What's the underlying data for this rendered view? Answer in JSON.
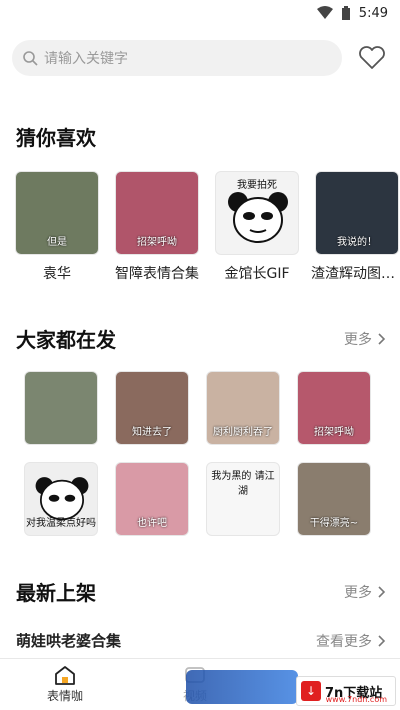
{
  "status": {
    "time": "5:49"
  },
  "search": {
    "placeholder": "请输入关键字"
  },
  "guess": {
    "title": "猜你喜欢",
    "items": [
      {
        "name": "袁华",
        "caption": "但是",
        "bg": "#6e7a60"
      },
      {
        "name": "智障表情合集",
        "caption": "招架呼呦",
        "bg": "#b0556a"
      },
      {
        "name": "金馆长GIF",
        "caption": "我要拍死",
        "bg": "#f3f3f3"
      },
      {
        "name": "渣渣辉动图表情",
        "caption": "我说的！",
        "bg": "#2c3540"
      }
    ]
  },
  "hot": {
    "title": "大家都在发",
    "more": "更多",
    "items": [
      {
        "caption": "",
        "bg": "#7b8670"
      },
      {
        "caption": "知进去了",
        "bg": "#8a6a5e"
      },
      {
        "caption": "厨利厨利吞了",
        "bg": "#c9b2a2"
      },
      {
        "caption": "招架呼呦",
        "bg": "#b6586c"
      },
      {
        "caption": "对我温柔点好吗",
        "bg": "#efefef"
      },
      {
        "caption": "也许吧",
        "bg": "#d99aa6"
      },
      {
        "caption": "我为黑的 请江湖",
        "bg": "#f7f7f7"
      },
      {
        "caption": "干得漂亮~",
        "bg": "#8a7d6e"
      }
    ]
  },
  "latest": {
    "title": "最新上架",
    "more": "更多",
    "item_name": "萌娃哄老婆合集",
    "view_more": "查看更多"
  },
  "nav": {
    "items": [
      {
        "label": "表情咖",
        "active": true
      },
      {
        "label": "视频",
        "active": false
      }
    ]
  },
  "watermark": {
    "text": "7n下载站",
    "sub": "www.7ndn.com"
  },
  "colors": {
    "accent": "#f5a623",
    "text": "#1a1a1a",
    "muted": "#888888"
  }
}
